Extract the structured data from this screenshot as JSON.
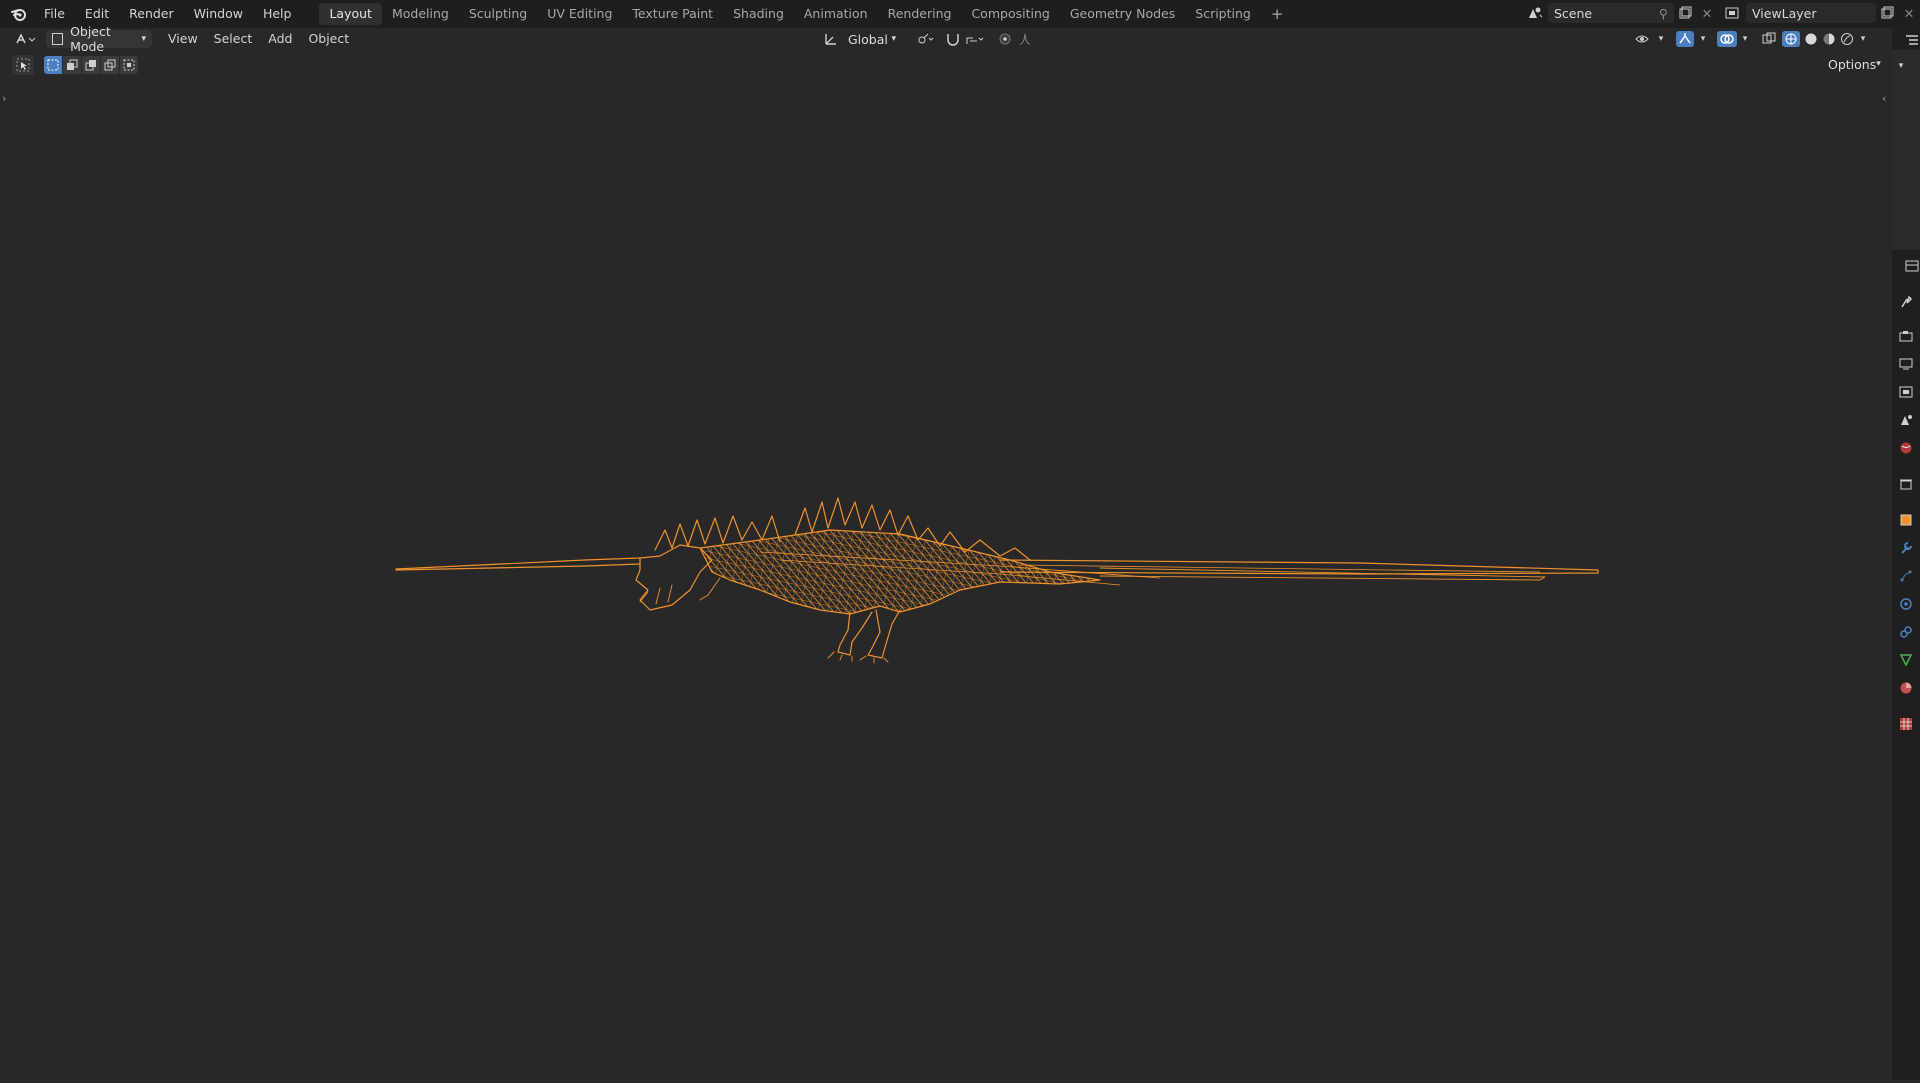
{
  "menu": [
    "File",
    "Edit",
    "Render",
    "Window",
    "Help"
  ],
  "workspace_tabs": [
    "Layout",
    "Modeling",
    "Sculpting",
    "UV Editing",
    "Texture Paint",
    "Shading",
    "Animation",
    "Rendering",
    "Compositing",
    "Geometry Nodes",
    "Scripting"
  ],
  "active_tab": "Layout",
  "add_workspace_label": "+",
  "scene_name": "Scene",
  "view_layer_name": "ViewLayer",
  "header": {
    "mode": "Object Mode",
    "menus": [
      "View",
      "Select",
      "Add",
      "Object"
    ],
    "transform_orientation": "Global",
    "options_label": "Options"
  },
  "colors": {
    "wire": "#f0922b",
    "background": "#282828",
    "topbar": "#1e1e1e",
    "accent_blue": "#4a7fc1"
  },
  "property_icons": [
    "tool-icon",
    "render-icon",
    "output-icon",
    "view-layer-icon",
    "scene-icon",
    "world-icon",
    "collection-icon",
    "object-icon",
    "modifier-icon",
    "particles-icon",
    "physics-icon",
    "constraints-icon",
    "data-icon",
    "material-icon",
    "texture-icon"
  ]
}
